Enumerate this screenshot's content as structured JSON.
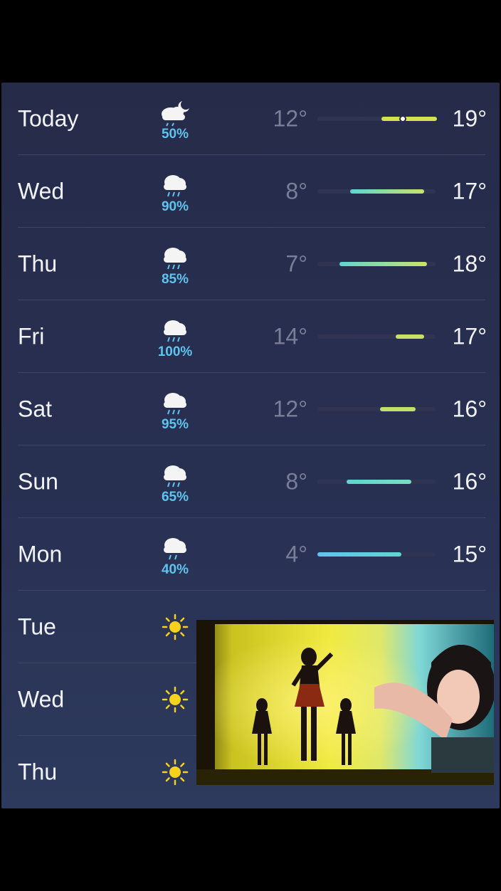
{
  "forecast": {
    "days": [
      {
        "day": "Today",
        "precip": "50%",
        "low": "12°",
        "high": "19°",
        "icon": "cloud-moon-rain-icon"
      },
      {
        "day": "Wed",
        "precip": "90%",
        "low": "8°",
        "high": "17°",
        "icon": "cloud-rain-icon"
      },
      {
        "day": "Thu",
        "precip": "85%",
        "low": "7°",
        "high": "18°",
        "icon": "cloud-rain-icon"
      },
      {
        "day": "Fri",
        "precip": "100%",
        "low": "14°",
        "high": "17°",
        "icon": "cloud-rain-icon"
      },
      {
        "day": "Sat",
        "precip": "95%",
        "low": "12°",
        "high": "16°",
        "icon": "cloud-rain-icon"
      },
      {
        "day": "Sun",
        "precip": "65%",
        "low": "8°",
        "high": "16°",
        "icon": "cloud-rain-icon"
      },
      {
        "day": "Mon",
        "precip": "40%",
        "low": "4°",
        "high": "15°",
        "icon": "cloud-rain-icon"
      },
      {
        "day": "Tue",
        "icon": "sun-icon"
      },
      {
        "day": "Wed",
        "icon": "sun-icon"
      },
      {
        "day": "Thu",
        "icon": "sun-icon"
      }
    ]
  },
  "colors": {
    "precip": "#5ec3ee",
    "bar_cool": "#5dd6d0",
    "bar_warm": "#d3e34d",
    "background": "#272d4c"
  }
}
